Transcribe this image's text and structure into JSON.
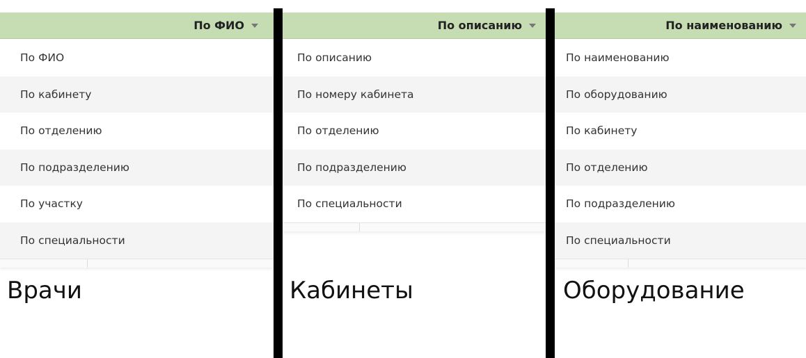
{
  "panels": [
    {
      "selected": "По ФИО",
      "caption": "Врачи",
      "items": [
        "По ФИО",
        "По кабинету",
        "По отделению",
        "По подразделению",
        "По участку",
        "По специальности"
      ]
    },
    {
      "selected": "По описанию",
      "caption": "Кабинеты",
      "items": [
        "По описанию",
        "По номеру кабинета",
        "По отделению",
        "По подразделению",
        "По специальности"
      ]
    },
    {
      "selected": "По наименованию",
      "caption": "Оборудование",
      "items": [
        "По наименованию",
        "По оборудованию",
        "По кабинету",
        "По отделению",
        "По подразделению",
        "По специальности"
      ]
    }
  ],
  "colors": {
    "header_bg": "#c6ddb3",
    "divider": "#000000",
    "alt_row": "#f4f4f4"
  },
  "icons": {
    "caret": "chevron-down-icon"
  }
}
